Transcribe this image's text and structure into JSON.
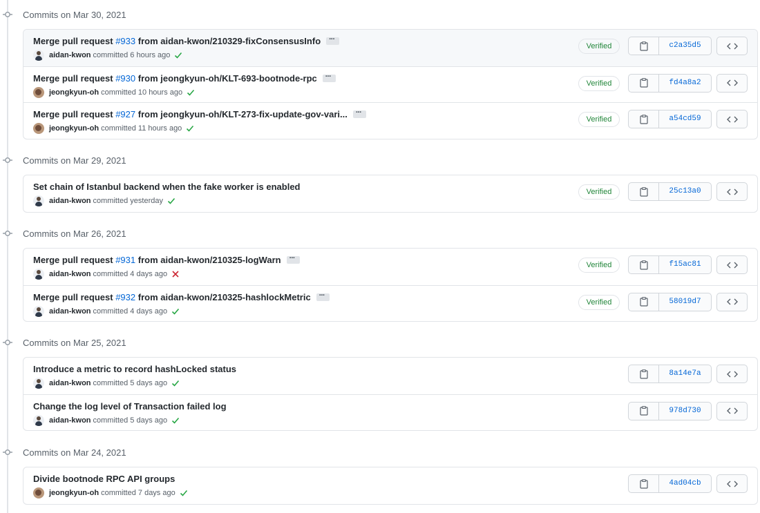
{
  "groups": [
    {
      "title": "Commits on Mar 30, 2021",
      "commits": [
        {
          "prefix": "Merge pull request ",
          "pr": "#933",
          "suffix": " from aidan-kwon/210329-fixConsensusInfo",
          "author": "aidan-kwon",
          "avatar": "a",
          "time": "committed 6 hours ago",
          "status": "success",
          "verified": "Verified",
          "sha": "c2a35d5",
          "highlight": true,
          "ellipsis": true
        },
        {
          "prefix": "Merge pull request ",
          "pr": "#930",
          "suffix": " from jeongkyun-oh/KLT-693-bootnode-rpc",
          "author": "jeongkyun-oh",
          "avatar": "j",
          "time": "committed 10 hours ago",
          "status": "success",
          "verified": "Verified",
          "sha": "fd4a8a2",
          "ellipsis": true
        },
        {
          "prefix": "Merge pull request ",
          "pr": "#927",
          "suffix": " from jeongkyun-oh/KLT-273-fix-update-gov-vari...",
          "author": "jeongkyun-oh",
          "avatar": "j",
          "time": "committed 11 hours ago",
          "status": "success",
          "verified": "Verified",
          "sha": "a54cd59",
          "ellipsis": true
        }
      ]
    },
    {
      "title": "Commits on Mar 29, 2021",
      "commits": [
        {
          "prefix": "Set chain of Istanbul backend when the fake worker is enabled",
          "author": "aidan-kwon",
          "avatar": "a",
          "time": "committed yesterday",
          "status": "success",
          "verified": "Verified",
          "sha": "25c13a0"
        }
      ]
    },
    {
      "title": "Commits on Mar 26, 2021",
      "commits": [
        {
          "prefix": "Merge pull request ",
          "pr": "#931",
          "suffix": " from aidan-kwon/210325-logWarn",
          "author": "aidan-kwon",
          "avatar": "a",
          "time": "committed 4 days ago",
          "status": "failure",
          "verified": "Verified",
          "sha": "f15ac81",
          "ellipsis": true
        },
        {
          "prefix": "Merge pull request ",
          "pr": "#932",
          "suffix": " from aidan-kwon/210325-hashlockMetric",
          "author": "aidan-kwon",
          "avatar": "a",
          "time": "committed 4 days ago",
          "status": "success",
          "verified": "Verified",
          "sha": "58019d7",
          "ellipsis": true
        }
      ]
    },
    {
      "title": "Commits on Mar 25, 2021",
      "commits": [
        {
          "prefix": "Introduce a metric to record hashLocked status",
          "author": "aidan-kwon",
          "avatar": "a",
          "time": "committed 5 days ago",
          "status": "success",
          "sha": "8a14e7a"
        },
        {
          "prefix": "Change the log level of Transaction failed log",
          "author": "aidan-kwon",
          "avatar": "a",
          "time": "committed 5 days ago",
          "status": "success",
          "sha": "978d730"
        }
      ]
    },
    {
      "title": "Commits on Mar 24, 2021",
      "commits": [
        {
          "prefix": "Divide bootnode RPC API groups",
          "author": "jeongkyun-oh",
          "avatar": "j",
          "time": "committed 7 days ago",
          "status": "success",
          "sha": "4ad04cb"
        }
      ]
    }
  ],
  "icons": {
    "copy": "clipboard-icon",
    "browse": "code-icon",
    "success": "check-icon",
    "failure": "x-icon",
    "node": "git-commit-icon"
  },
  "colors": {
    "link": "#0366d6",
    "success": "#28a745",
    "failure": "#cb2431",
    "verified": "#22863a"
  }
}
